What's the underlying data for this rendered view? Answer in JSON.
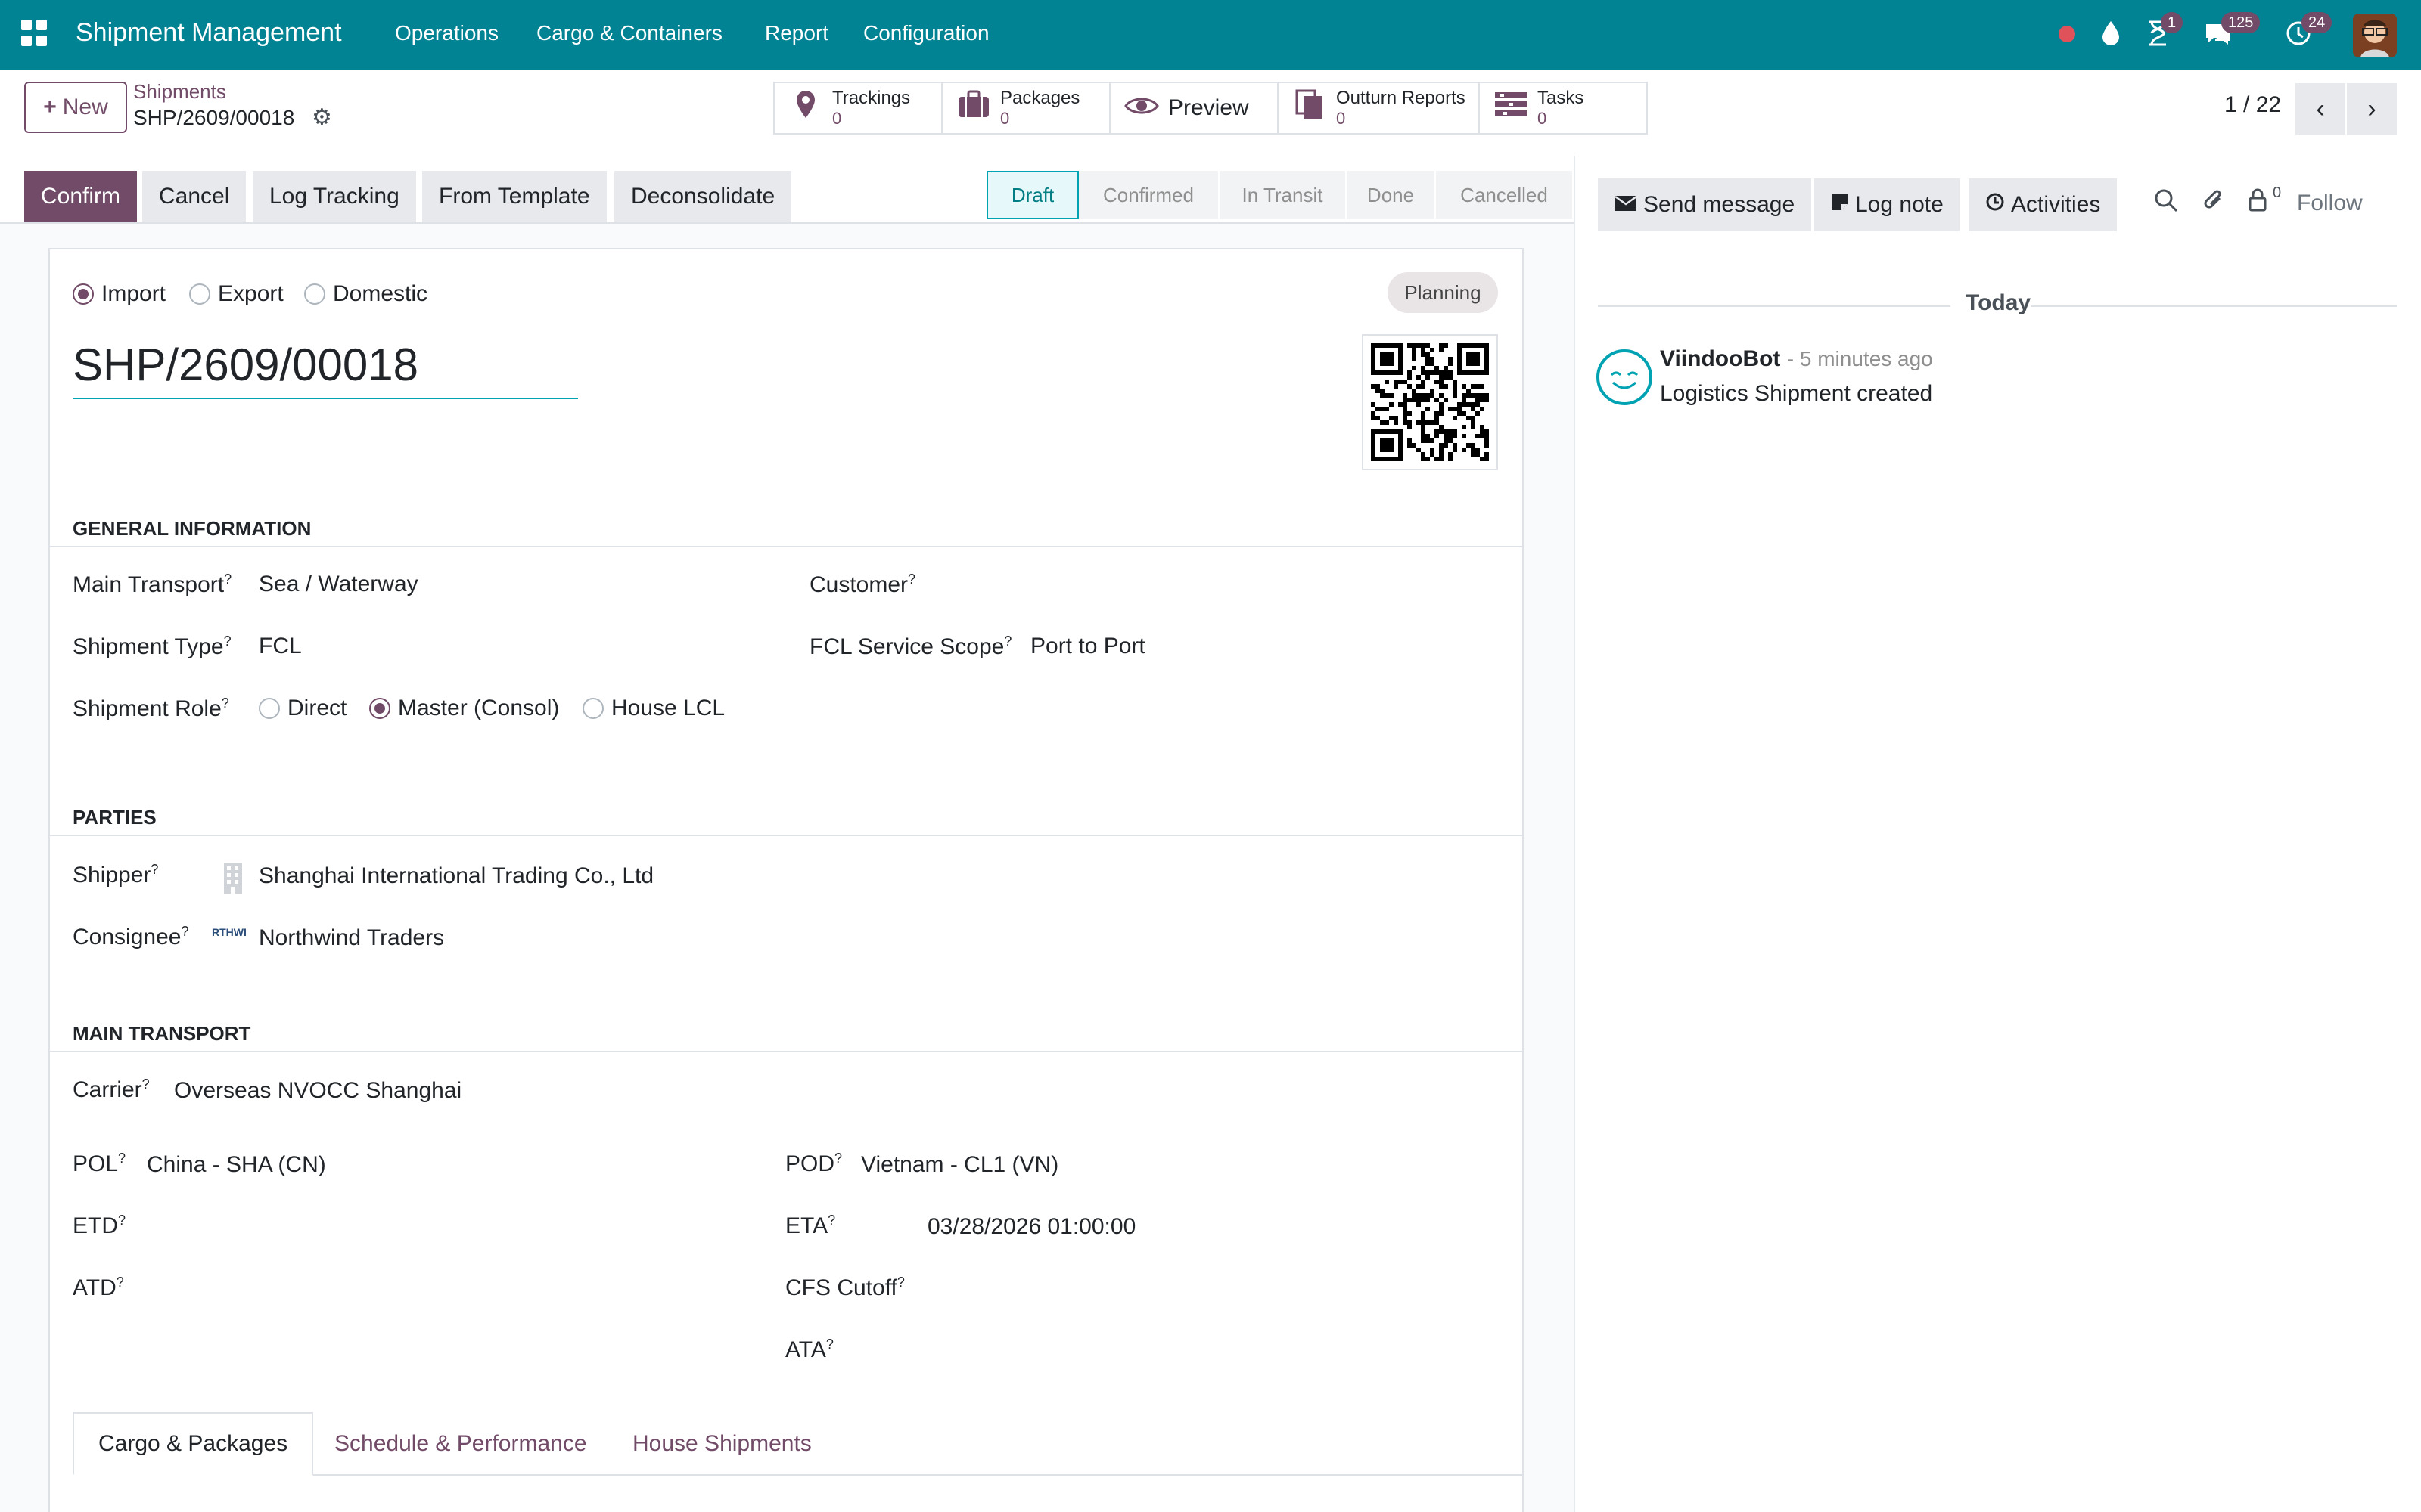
{
  "navbar": {
    "app_title": "Shipment Management",
    "menu": [
      "Operations",
      "Cargo & Containers",
      "Report",
      "Configuration"
    ],
    "activity_badge": "1",
    "messages_badge": "125",
    "updates_badge": "24"
  },
  "control": {
    "new_label": "New",
    "breadcrumb_parent": "Shipments",
    "breadcrumb_current": "SHP/2609/00018",
    "smart_buttons": [
      {
        "label": "Trackings",
        "count": "0",
        "icon": "map-pin-icon"
      },
      {
        "label": "Packages",
        "count": "0",
        "icon": "briefcase-icon"
      },
      {
        "label": "Preview",
        "count": "",
        "icon": "eye-icon"
      },
      {
        "label": "Outturn Reports",
        "count": "0",
        "icon": "documents-icon"
      },
      {
        "label": "Tasks",
        "count": "0",
        "icon": "tasks-icon"
      }
    ],
    "pager": "1 / 22"
  },
  "statusbar": {
    "actions": [
      "Confirm",
      "Cancel",
      "Log Tracking",
      "From Template",
      "Deconsolidate"
    ],
    "stages": [
      "Draft",
      "Confirmed",
      "In Transit",
      "Done",
      "Cancelled"
    ],
    "active_stage": "Draft"
  },
  "form": {
    "direction_options": [
      "Import",
      "Export",
      "Domestic"
    ],
    "direction_selected": "Import",
    "planning_badge": "Planning",
    "name": "SHP/2609/00018",
    "general": {
      "section_title": "General Information",
      "main_transport_label": "Main Transport",
      "main_transport_value": "Sea / Waterway",
      "customer_label": "Customer",
      "customer_value": "",
      "shipment_type_label": "Shipment Type",
      "shipment_type_value": "FCL",
      "fcl_scope_label": "FCL Service Scope",
      "fcl_scope_value": "Port to Port",
      "role_label": "Shipment Role",
      "role_options": [
        "Direct",
        "Master (Consol)",
        "House LCL"
      ],
      "role_selected": "Master (Consol)"
    },
    "parties": {
      "section_title": "Parties",
      "shipper_label": "Shipper",
      "shipper_value": "Shanghai International Trading Co., Ltd",
      "consignee_label": "Consignee",
      "consignee_value": "Northwind Traders",
      "consignee_logo_text": "RTHWI"
    },
    "main_transport": {
      "section_title": "Main Transport",
      "carrier_label": "Carrier",
      "carrier_value": "Overseas NVOCC Shanghai",
      "pol_label": "POL",
      "pol_value": "China - SHA (CN)",
      "pod_label": "POD",
      "pod_value": "Vietnam - CL1 (VN)",
      "etd_label": "ETD",
      "eta_label": "ETA",
      "eta_value": "03/28/2026 01:00:00",
      "atd_label": "ATD",
      "cfs_label": "CFS Cutoff",
      "ata_label": "ATA"
    },
    "tabs": [
      "Cargo & Packages",
      "Schedule & Performance",
      "House Shipments"
    ],
    "active_tab": "Cargo & Packages"
  },
  "chatter": {
    "send_message": "Send message",
    "log_note": "Log note",
    "activities": "Activities",
    "followers_count": "0",
    "follow": "Follow",
    "today": "Today",
    "message_author": "ViindooBot",
    "message_time": "- 5 minutes ago",
    "message_body": "Logistics Shipment created"
  },
  "colors": {
    "navbar": "#018393",
    "brand": "#714B67",
    "accent": "#01a2b2"
  }
}
